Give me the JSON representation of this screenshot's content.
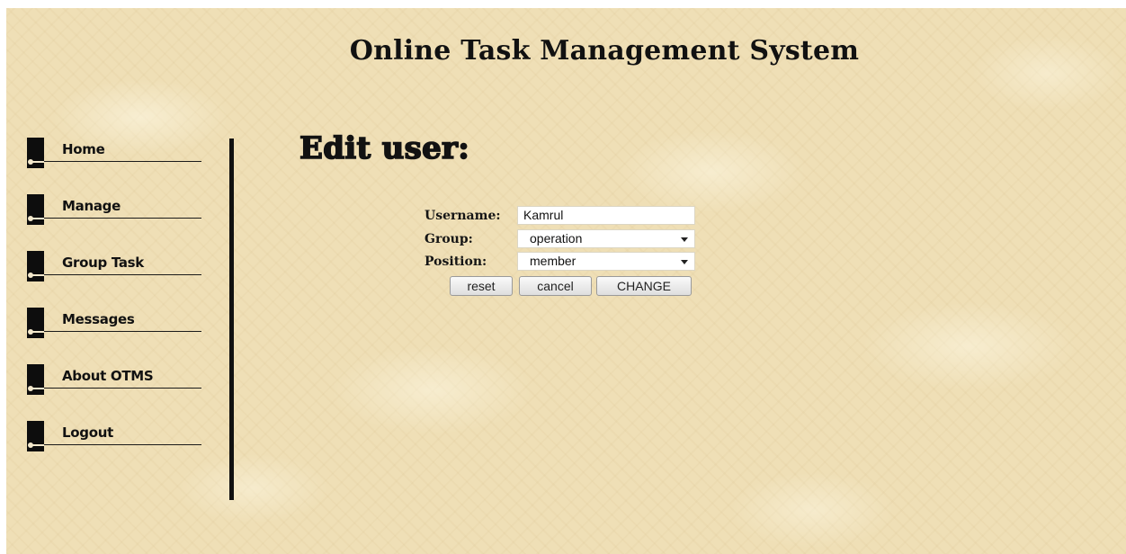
{
  "header": {
    "title": "Online Task Management System"
  },
  "sidebar": {
    "items": [
      {
        "label": "Home"
      },
      {
        "label": "Manage"
      },
      {
        "label": "Group Task"
      },
      {
        "label": "Messages"
      },
      {
        "label": "About OTMS"
      },
      {
        "label": "Logout"
      }
    ]
  },
  "main": {
    "heading": "Edit user:",
    "form": {
      "username_label": "Username:",
      "username_value": "Kamrul",
      "group_label": "Group:",
      "group_value": "operation",
      "position_label": "Position:",
      "position_value": "member",
      "reset_label": "reset",
      "cancel_label": "cancel",
      "change_label": "CHANGE"
    }
  },
  "icons": {
    "nav_marker": "nav-bullet-icon",
    "dropdown": "chevron-down-icon"
  },
  "colors": {
    "background": "#efdfb6",
    "text": "#111111",
    "marker": "#0d0d0d"
  }
}
